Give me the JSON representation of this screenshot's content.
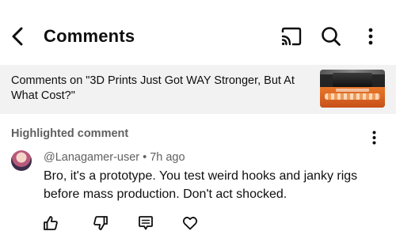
{
  "header": {
    "title": "Comments",
    "icons": {
      "back": "chevron-left-icon",
      "cast": "cast-icon",
      "search": "search-icon",
      "more": "more-vert-icon"
    }
  },
  "video": {
    "context_text": "Comments on \"3D Prints Just Got WAY Stronger, But At What Cost?\"",
    "thumbnail": "video-thumbnail"
  },
  "highlighted": {
    "section_label": "Highlighted comment",
    "comment": {
      "author": "@Lanagamer-user",
      "separator": "•",
      "time": "7h ago",
      "text": "Bro, it's a prototype. You test weird hooks and janky rigs before mass production. Don't act shocked."
    },
    "actions": [
      "like-icon",
      "dislike-icon",
      "reply-icon",
      "heart-icon"
    ]
  },
  "colors": {
    "background": "#ffffff",
    "banner_background": "#f2f2f2",
    "primary_text": "#0f0f0f",
    "secondary_text": "#606060"
  }
}
